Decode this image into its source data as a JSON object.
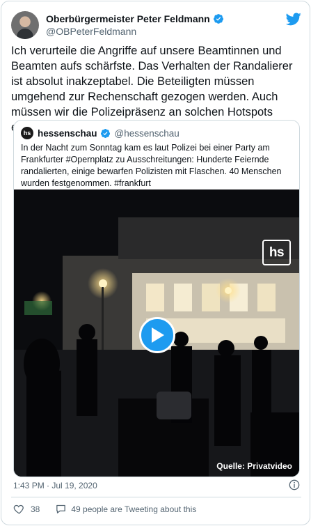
{
  "author": {
    "name": "Oberbürgermeister Peter Feldmann",
    "handle": "@OBPeterFeldmann",
    "verified": true
  },
  "tweet": {
    "text": "Ich verurteile die Angriffe auf unsere Beamtinnen und Beamten aufs schärfste. Das Verhalten der Randalierer ist absolut inakzeptabel. Die Beteiligten müssen umgehend zur Rechenschaft gezogen werden. Auch müssen wir die Polizeipräsenz an solchen Hotspots erhöhen.",
    "timestamp": "1:43 PM · Jul 19, 2020"
  },
  "quoted": {
    "avatar_text": "hs",
    "name": "hessenschau",
    "handle": "@hessenschau",
    "verified": true,
    "text": "In der Nacht zum Sonntag kam es laut Polizei bei einer Party am Frankfurter #Opernplatz zu Ausschreitungen: Hunderte Feiernde randalierten, einige bewarfen Polizisten mit Flaschen. 40 Menschen wurden festgenommen. #frankfurt",
    "video": {
      "logo_text": "hs",
      "source_label": "Quelle: Privatvideo"
    }
  },
  "footer": {
    "like_count": "38",
    "tweeting_about": "49 people are Tweeting about this"
  },
  "colors": {
    "accent": "#1d9bf0",
    "secondary_text": "#536471",
    "border": "#cfd9de"
  },
  "icons": [
    "twitter-bird-icon",
    "verified-badge-icon",
    "play-icon",
    "info-icon",
    "heart-icon",
    "comment-bubble-icon"
  ]
}
